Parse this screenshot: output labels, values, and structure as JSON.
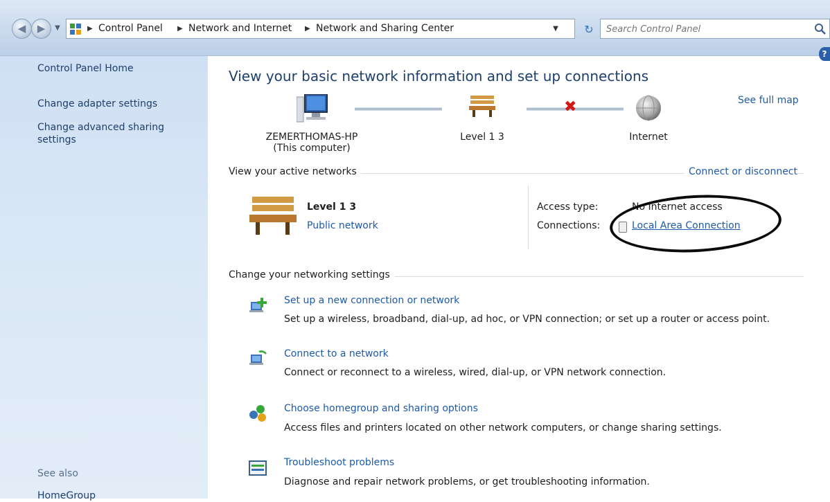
{
  "addressbar": {
    "breadcrumbs": [
      "Control Panel",
      "Network and Internet",
      "Network and Sharing Center"
    ],
    "search_placeholder": "Search Control Panel"
  },
  "sidebar": {
    "home": "Control Panel Home",
    "adapter": "Change adapter settings",
    "advanced": "Change advanced sharing settings",
    "see_also": "See also",
    "homegroup": "HomeGroup"
  },
  "main": {
    "title": "View your basic network information and set up connections",
    "see_full_map": "See full map",
    "map": {
      "computer_name": "ZEMERTHOMAS-HP",
      "computer_sub": "(This computer)",
      "network_name": "Level 1  3",
      "internet": "Internet"
    },
    "active_networks": {
      "heading": "View your active networks",
      "connect_link": "Connect or disconnect",
      "network_name": "Level 1  3",
      "network_type": "Public network",
      "access_type_label": "Access type:",
      "access_type_value": "No Internet access",
      "connections_label": "Connections:",
      "connection_value": "Local Area Connection"
    },
    "settings": {
      "heading": "Change your networking settings",
      "tasks": [
        {
          "link": "Set up a new connection or network",
          "desc": "Set up a wireless, broadband, dial-up, ad hoc, or VPN connection; or set up a router or access point."
        },
        {
          "link": "Connect to a network",
          "desc": "Connect or reconnect to a wireless, wired, dial-up, or VPN network connection."
        },
        {
          "link": "Choose homegroup and sharing options",
          "desc": "Access files and printers located on other network computers, or change sharing settings."
        },
        {
          "link": "Troubleshoot problems",
          "desc": "Diagnose and repair network problems, or get troubleshooting information."
        }
      ]
    }
  },
  "colors": {
    "link": "#1e5aa8",
    "sidebar_link": "#1e3f6b",
    "title": "#1e3f6b",
    "error_x": "#d21717"
  }
}
